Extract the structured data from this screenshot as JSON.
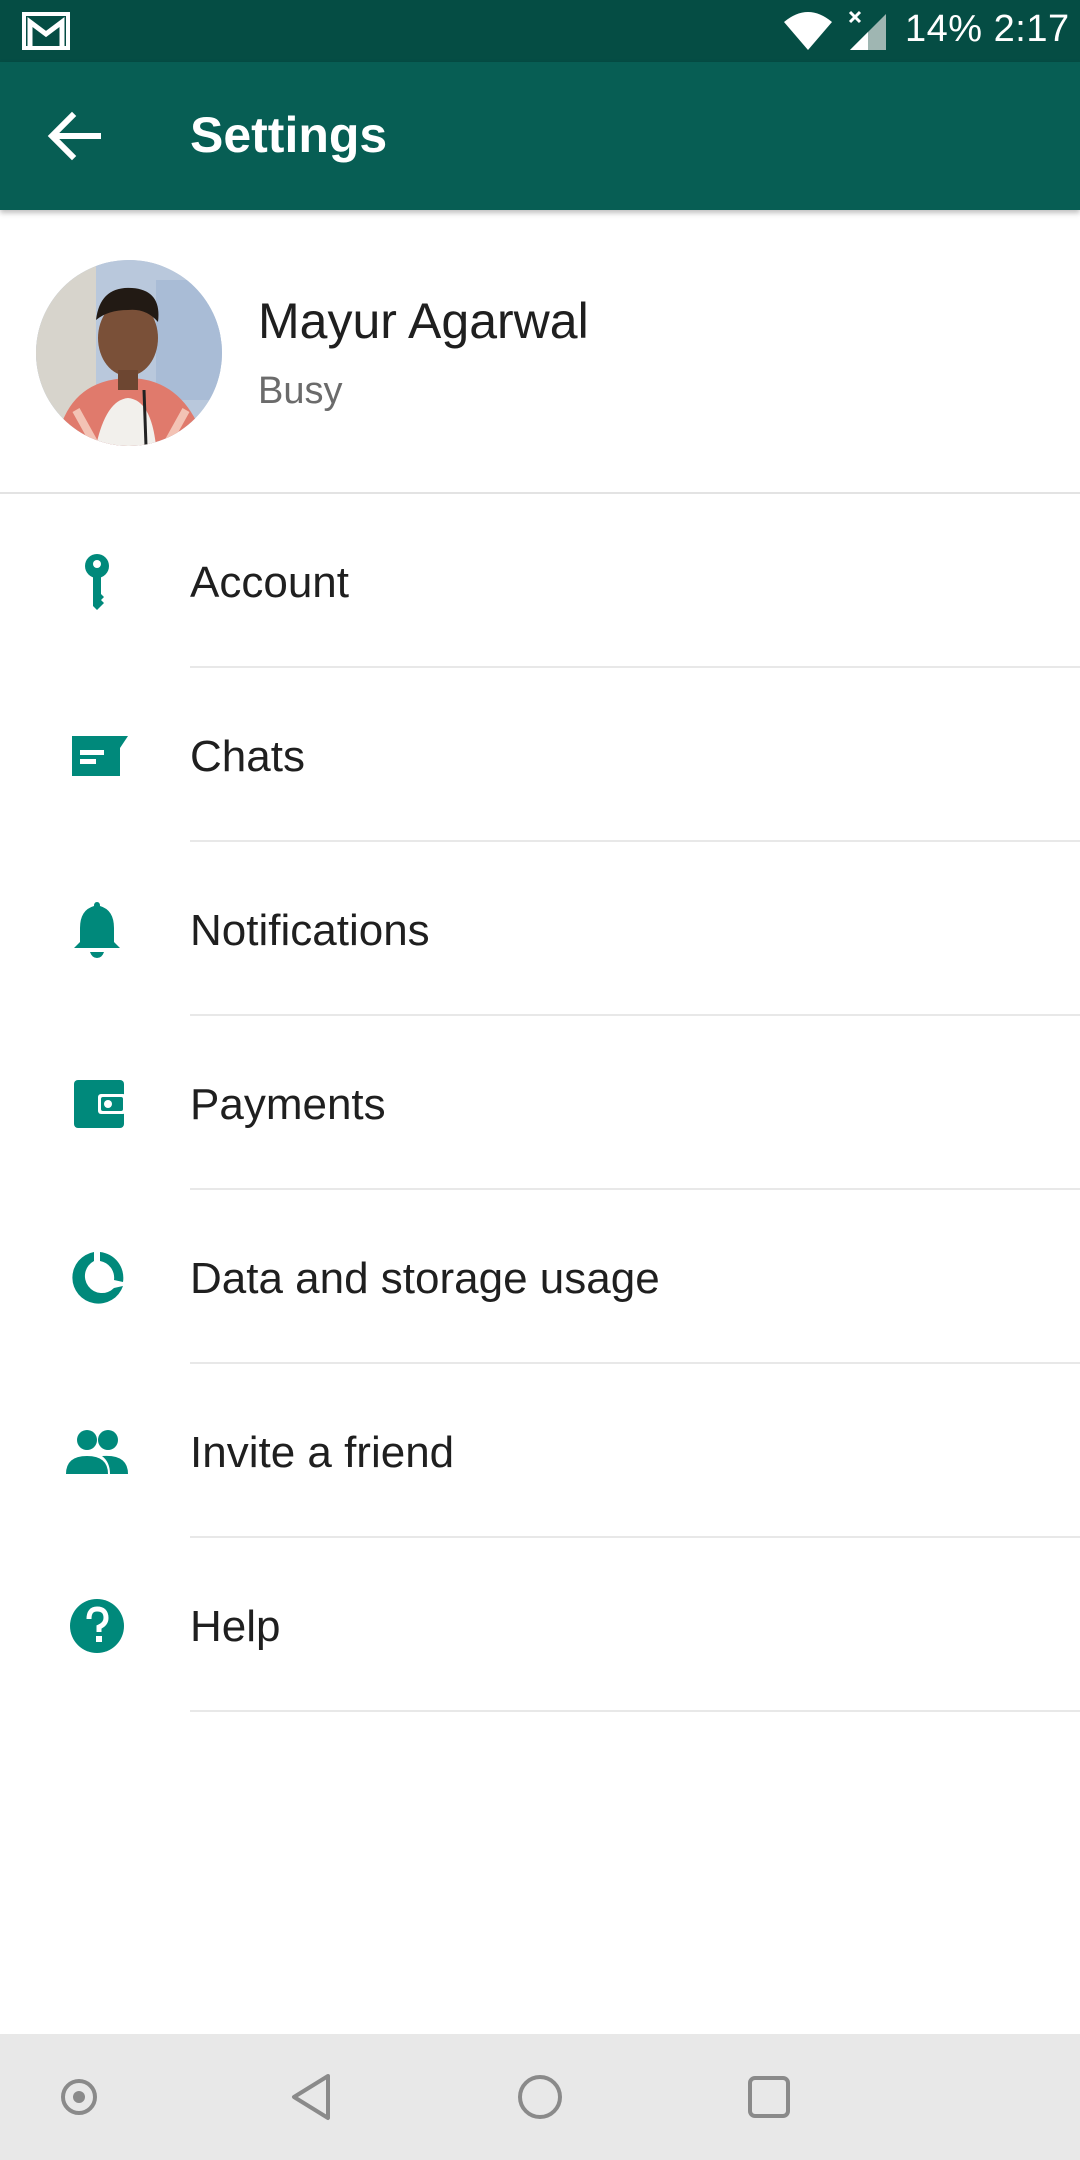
{
  "status_bar": {
    "battery": "14%",
    "time": "2:17",
    "icons": [
      "gmail-icon",
      "wifi-icon",
      "signal-icon"
    ]
  },
  "app_bar": {
    "title": "Settings",
    "back_icon": "arrow-back-icon"
  },
  "profile": {
    "name": "Mayur Agarwal",
    "about": "Busy"
  },
  "menu": [
    {
      "label": "Account",
      "icon": "key-icon"
    },
    {
      "label": "Chats",
      "icon": "chat-icon"
    },
    {
      "label": "Notifications",
      "icon": "bell-icon"
    },
    {
      "label": "Payments",
      "icon": "wallet-icon"
    },
    {
      "label": "Data and storage usage",
      "icon": "data-usage-icon"
    },
    {
      "label": "Invite a friend",
      "icon": "people-icon"
    },
    {
      "label": "Help",
      "icon": "help-icon"
    }
  ],
  "nav_bar": [
    "assistant-dot-icon",
    "back-triangle-icon",
    "home-circle-icon",
    "recents-square-icon"
  ],
  "colors": {
    "status_bar": "#054d44",
    "app_bar": "#075e54",
    "accent": "#00897b",
    "nav_bar": "#e8e8e8"
  }
}
